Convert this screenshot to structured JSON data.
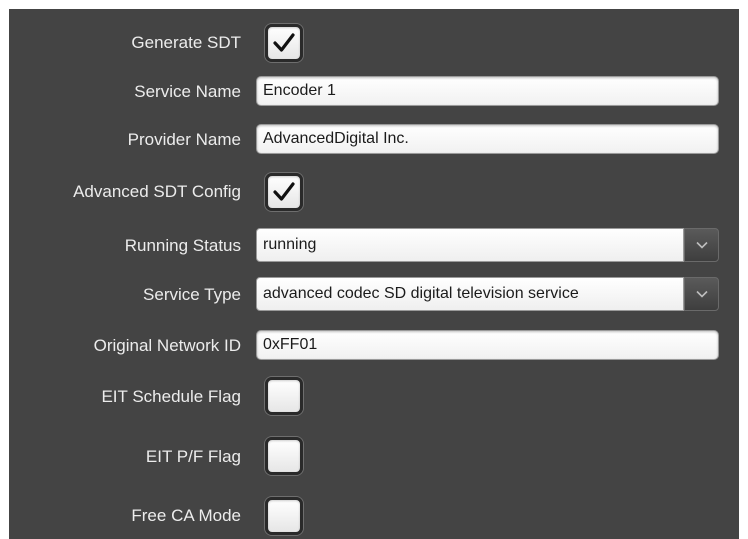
{
  "form": {
    "generate_sdt": {
      "label": "Generate SDT",
      "checked": true
    },
    "service_name": {
      "label": "Service Name",
      "value": "Encoder 1"
    },
    "provider_name": {
      "label": "Provider Name",
      "value": "AdvancedDigital Inc."
    },
    "advanced_sdt_config": {
      "label": "Advanced SDT Config",
      "checked": true
    },
    "running_status": {
      "label": "Running Status",
      "value": "running"
    },
    "service_type": {
      "label": "Service Type",
      "value": "advanced codec SD digital television service"
    },
    "original_network_id": {
      "label": "Original Network ID",
      "value": "0xFF01"
    },
    "eit_schedule_flag": {
      "label": "EIT Schedule Flag",
      "checked": false
    },
    "eit_pf_flag": {
      "label": "EIT P/F Flag",
      "checked": false
    },
    "free_ca_mode": {
      "label": "Free CA Mode",
      "checked": false
    }
  },
  "colors": {
    "panel_background": "#444444",
    "label_text": "#ececec",
    "field_background": "#ffffff"
  },
  "icons": {
    "checkmark": "checkmark-icon",
    "dropdown": "chevron-down-icon"
  }
}
